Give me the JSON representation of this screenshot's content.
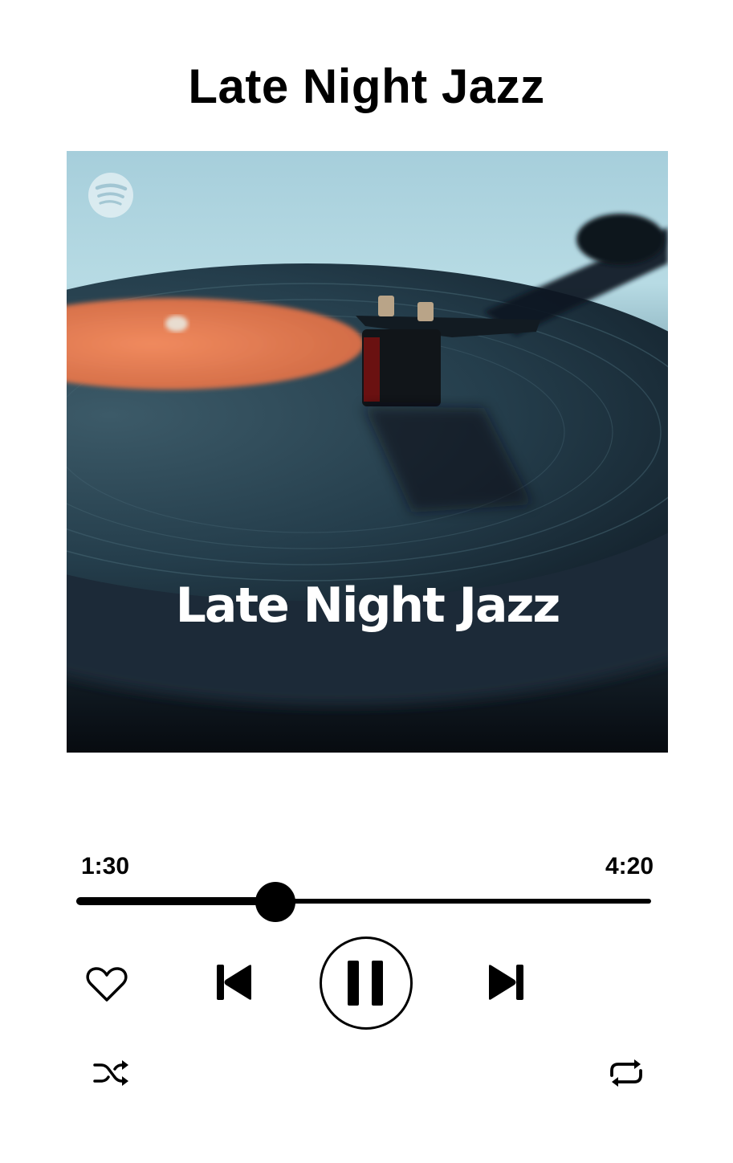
{
  "header": {
    "title": "Late Night Jazz"
  },
  "cover": {
    "title": "Late Night Jazz",
    "logo_icon": "spotify-logo-icon"
  },
  "playback": {
    "elapsed": "1:30",
    "total": "4:20",
    "progress_fraction": 0.3462
  },
  "controls": {
    "like_icon": "heart-icon",
    "previous_icon": "skip-previous-icon",
    "play_pause_icon": "pause-icon",
    "next_icon": "skip-next-icon",
    "shuffle_icon": "shuffle-icon",
    "repeat_icon": "repeat-icon"
  },
  "colors": {
    "foreground": "#000000",
    "background": "#ffffff",
    "cover_sky": "#a9cfdc",
    "record_label": "#e07a50"
  }
}
